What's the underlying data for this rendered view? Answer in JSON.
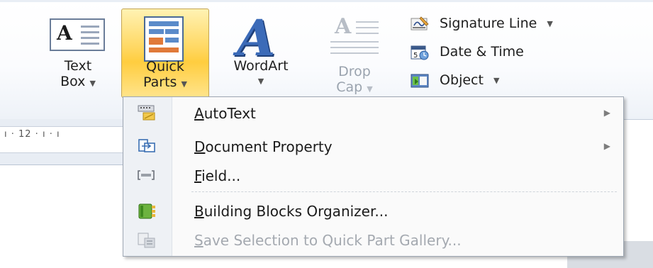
{
  "ribbon": {
    "text_box": {
      "line1": "Text",
      "line2": "Box",
      "arrow": "▼",
      "icon": "text-box-icon"
    },
    "quick_parts": {
      "line1": "Quick",
      "line2": "Parts",
      "arrow": "▼",
      "icon": "quick-parts-icon",
      "state": "pressed"
    },
    "wordart": {
      "line1": "WordArt",
      "arrow": "▼",
      "icon": "wordart-icon",
      "glyph": "A"
    },
    "drop_cap": {
      "line1": "Drop",
      "line2": "Cap",
      "arrow": "▼",
      "icon": "drop-cap-icon",
      "state": "disabled"
    },
    "signature_line": {
      "label": "Signature Line",
      "arrow": "▼",
      "icon": "signature-line-icon"
    },
    "date_time": {
      "label": "Date & Time",
      "icon": "date-time-icon"
    },
    "object": {
      "label": "Object",
      "arrow": "▼",
      "icon": "object-icon"
    }
  },
  "ruler": {
    "text": "ı · 12 · ı · ı"
  },
  "menu": {
    "items": [
      {
        "prefix": "",
        "accel": "A",
        "rest": "utoText",
        "submenu": "▶",
        "icon": "autotext-icon",
        "enabled": true
      },
      {
        "prefix": "",
        "accel": "D",
        "rest": "ocument Property",
        "submenu": "▶",
        "icon": "document-property-icon",
        "enabled": true
      },
      {
        "prefix": "",
        "accel": "F",
        "rest": "ield...",
        "icon": "field-icon",
        "enabled": true
      },
      {
        "prefix": "",
        "accel": "B",
        "rest": "uilding Blocks Organizer...",
        "icon": "building-blocks-icon",
        "enabled": true
      },
      {
        "prefix": "",
        "accel": "S",
        "rest": "ave Selection to Quick Part Gallery...",
        "icon": "save-selection-icon",
        "enabled": false
      }
    ]
  },
  "colors": {
    "pressed_button": "#ffd760",
    "wordart_blue": "#3c6bb8",
    "menu_bg": "#fafafa",
    "disabled_text": "#a4a9b0"
  }
}
